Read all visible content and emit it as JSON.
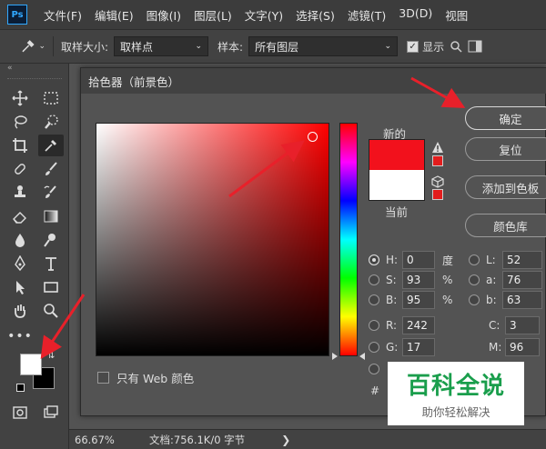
{
  "menubar": {
    "logo": "Ps",
    "items": [
      "文件(F)",
      "编辑(E)",
      "图像(I)",
      "图层(L)",
      "文字(Y)",
      "选择(S)",
      "滤镜(T)",
      "3D(D)",
      "视图"
    ]
  },
  "options": {
    "sample_size_label": "取样大小:",
    "sample_size_value": "取样点",
    "sample_label": "样本:",
    "sample_value": "所有图层",
    "show_label": "显示"
  },
  "dialog": {
    "title": "拾色器（前景色）",
    "new_label": "新的",
    "current_label": "当前",
    "buttons": {
      "ok": "确定",
      "reset": "复位",
      "add_swatch": "添加到色板",
      "library": "颜色库"
    },
    "web_only_label": "只有 Web 颜色",
    "hash_label": "#",
    "fields": {
      "H": {
        "label": "H:",
        "value": "0",
        "unit": "度"
      },
      "S": {
        "label": "S:",
        "value": "93",
        "unit": "%"
      },
      "B": {
        "label": "B:",
        "value": "95",
        "unit": "%"
      },
      "R": {
        "label": "R:",
        "value": "242"
      },
      "G": {
        "label": "G:",
        "value": "17"
      },
      "L": {
        "label": "L:",
        "value": "52"
      },
      "a": {
        "label": "a:",
        "value": "76"
      },
      "b": {
        "label": "b:",
        "value": "63"
      },
      "C": {
        "label": "C:",
        "value": "3"
      },
      "M": {
        "label": "M:",
        "value": "96"
      }
    },
    "colors": {
      "new": "#f2111c",
      "current": "#ffffff"
    }
  },
  "status": {
    "zoom": "66.67%",
    "doc": "文档:756.1K/0 字节"
  },
  "watermark": {
    "title": "百科全说",
    "subtitle": "助你轻松解决"
  }
}
